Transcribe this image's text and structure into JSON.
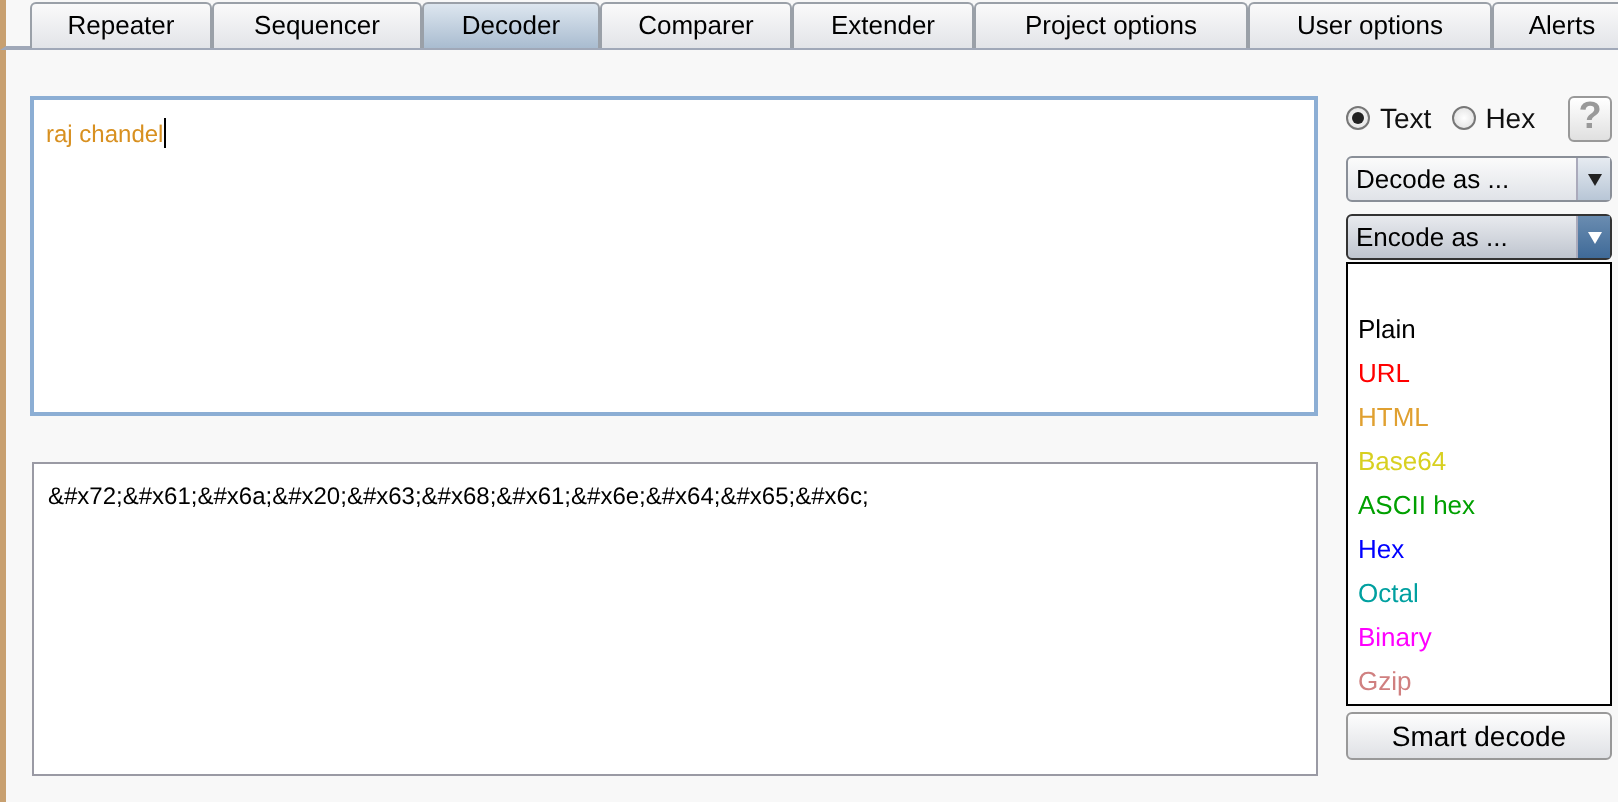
{
  "tabs": [
    {
      "label": "Repeater",
      "selected": false
    },
    {
      "label": "Sequencer",
      "selected": false
    },
    {
      "label": "Decoder",
      "selected": true
    },
    {
      "label": "Comparer",
      "selected": false
    },
    {
      "label": "Extender",
      "selected": false
    },
    {
      "label": "Project options",
      "selected": false
    },
    {
      "label": "User options",
      "selected": false
    },
    {
      "label": "Alerts",
      "selected": false
    }
  ],
  "input": {
    "value": "raj chandel"
  },
  "output": {
    "value": "&#x72;&#x61;&#x6a;&#x20;&#x63;&#x68;&#x61;&#x6e;&#x64;&#x65;&#x6c;"
  },
  "mode": [
    {
      "label": "Text",
      "selected": true
    },
    {
      "label": "Hex",
      "selected": false
    }
  ],
  "help": {
    "label": "?"
  },
  "decode_dropdown": {
    "label": "Decode as ...",
    "expanded": false
  },
  "encode_dropdown": {
    "label": "Encode as ...",
    "expanded": true
  },
  "encode_options": [
    {
      "label": "Plain",
      "color": "#000000"
    },
    {
      "label": "URL",
      "color": "#ff0000"
    },
    {
      "label": "HTML",
      "color": "#e0a030"
    },
    {
      "label": "Base64",
      "color": "#d8d020"
    },
    {
      "label": "ASCII hex",
      "color": "#00a000"
    },
    {
      "label": "Hex",
      "color": "#0000ff"
    },
    {
      "label": "Octal",
      "color": "#00a0a0"
    },
    {
      "label": "Binary",
      "color": "#ff00ff"
    },
    {
      "label": "Gzip",
      "color": "#d08080"
    }
  ],
  "smart_decode": {
    "label": "Smart decode"
  }
}
